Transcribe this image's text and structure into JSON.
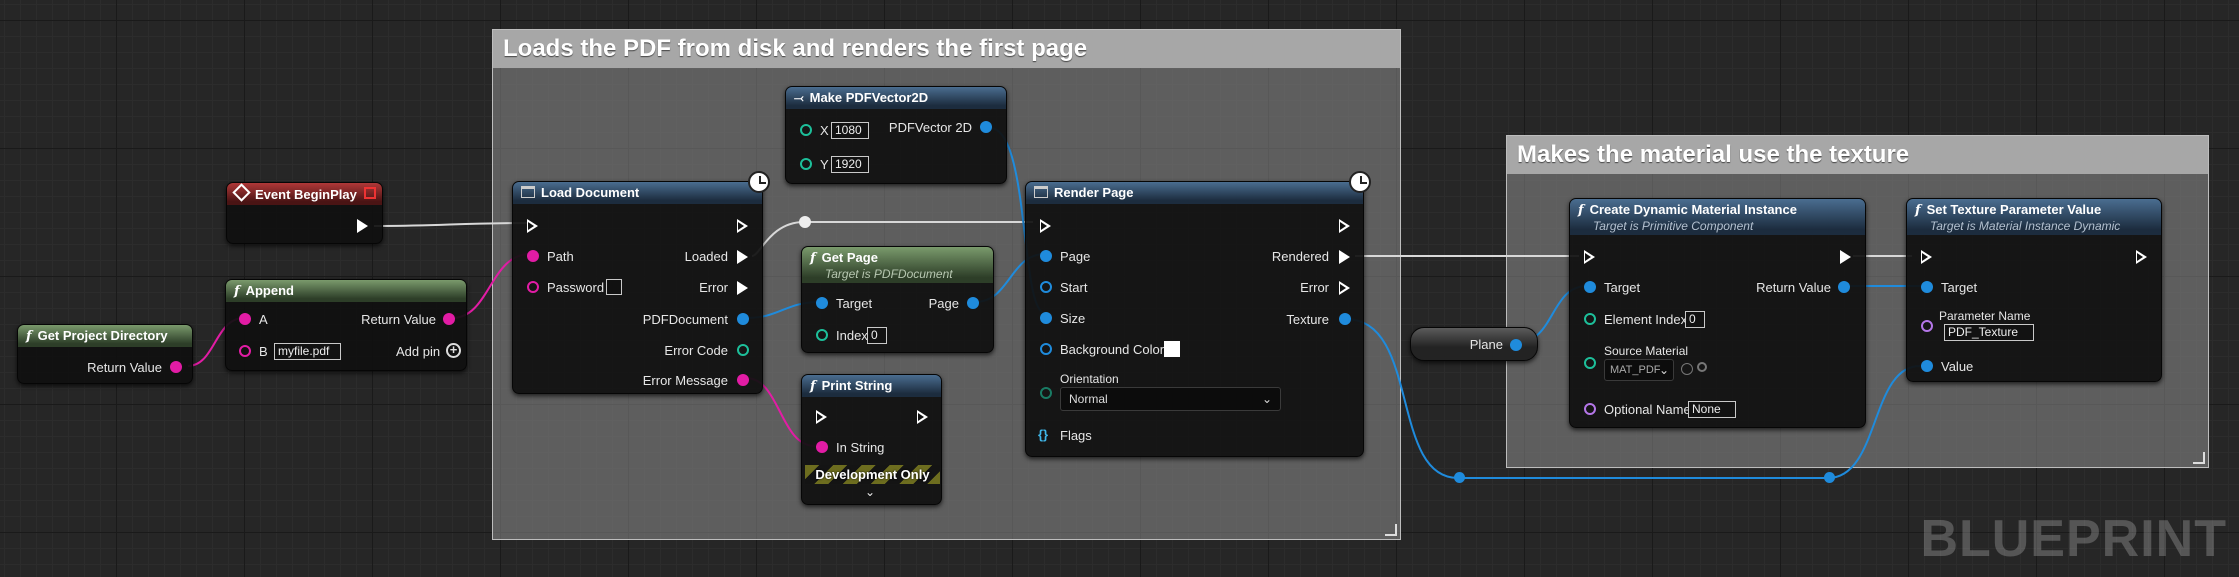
{
  "comments": {
    "pdf": "Loads the PDF from disk and renders the first page",
    "material": "Makes the material use the texture"
  },
  "watermark": "BLUEPRINT",
  "nodes": {
    "event_begin_play": {
      "title": "Event BeginPlay"
    },
    "get_project_directory": {
      "title": "Get Project Directory",
      "return_value": "Return Value"
    },
    "append": {
      "title": "Append",
      "a": "A",
      "b": "B",
      "b_value": "myfile.pdf",
      "return_value": "Return Value",
      "add_pin": "Add pin"
    },
    "load_document": {
      "title": "Load Document",
      "path": "Path",
      "password": "Password",
      "loaded": "Loaded",
      "error": "Error",
      "pdf_document": "PDFDocument",
      "error_code": "Error Code",
      "error_message": "Error Message"
    },
    "make_pdf_vector": {
      "title": "Make PDFVector2D",
      "x": "X",
      "x_value": "1080",
      "y": "Y",
      "y_value": "1920",
      "out": "PDFVector 2D"
    },
    "get_page": {
      "title": "Get Page",
      "subtitle": "Target is PDFDocument",
      "target": "Target",
      "index": "Index",
      "index_value": "0",
      "page": "Page"
    },
    "print_string": {
      "title": "Print String",
      "in_string": "In String",
      "dev_only": "Development Only"
    },
    "render_page": {
      "title": "Render Page",
      "page": "Page",
      "start": "Start",
      "size": "Size",
      "background_color": "Background Color",
      "orientation": "Orientation",
      "orientation_value": "Normal",
      "flags": "Flags",
      "rendered": "Rendered",
      "error": "Error",
      "texture": "Texture"
    },
    "plane": {
      "label": "Plane"
    },
    "create_dmi": {
      "title": "Create Dynamic Material Instance",
      "subtitle": "Target is Primitive Component",
      "target": "Target",
      "element_index": "Element Index",
      "element_index_value": "0",
      "source_material": "Source Material",
      "source_material_value": "MAT_PDF",
      "optional_name": "Optional Name",
      "optional_name_value": "None",
      "return_value": "Return Value"
    },
    "set_texture": {
      "title": "Set Texture Parameter Value",
      "subtitle": "Target is Material Instance Dynamic",
      "target": "Target",
      "parameter_name": "Parameter Name",
      "parameter_name_value": "PDF_Texture",
      "value": "Value"
    }
  },
  "colors": {
    "exec_wire": "#ffffff",
    "string_wire": "#e21ca5",
    "object_wire": "#1f8bdc",
    "struct_wire": "#1dbf9a"
  }
}
